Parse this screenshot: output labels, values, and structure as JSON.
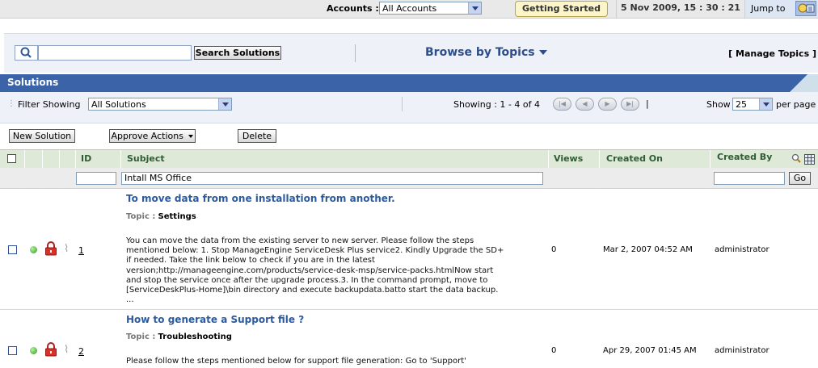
{
  "topbar": {
    "accounts_label": "Accounts :",
    "accounts_value": "All Accounts",
    "getting_started": "Getting Started",
    "datetime": "5 Nov 2009, 15 : 30 : 21",
    "jump_to": "Jump to"
  },
  "search": {
    "button": "Search Solutions",
    "browse": "Browse by Topics",
    "manage": "[ Manage Topics ]"
  },
  "section_title": "Solutions",
  "filter": {
    "label": "Filter Showing",
    "value": "All Solutions",
    "showing": "Showing : 1 - 4 of 4",
    "show_label": "Show",
    "show_value": "25",
    "per_page": "per page"
  },
  "actions": {
    "new": "New Solution",
    "approve": "Approve Actions",
    "delete": "Delete"
  },
  "columns": {
    "id": "ID",
    "subject": "Subject",
    "views": "Views",
    "created_on": "Created On",
    "created_by": "Created By"
  },
  "subject_filter": "Intall MS Office",
  "go": "Go",
  "topic_key": "Topic :",
  "rows": [
    {
      "id": "1",
      "title": "To move data from one installation from another.",
      "topic": "Settings",
      "description": "You can move the data from the existing server to new server. Please follow the steps\nmentioned below: 1. Stop ManageEngine ServiceDesk Plus service2. Kindly Upgrade the SD+\nif needed. Take the link below to check if you are in the latest\nversion;http://manageengine.com/products/service-desk-msp/service-packs.htmlNow start\nand stop the service once after the upgrade process.3. In the command prompt, move to\n[ServiceDeskPlus-Home]\\bin directory and execute backupdata.batto start the data backup.\n...",
      "views": "0",
      "created_on": "Mar 2, 2007 04:52 AM",
      "created_by": "administrator"
    },
    {
      "id": "2",
      "title": "How to generate a Support file ?",
      "topic": "Troubleshooting",
      "description": "Please follow the steps mentioned below for support file generation: Go to 'Support'",
      "views": "0",
      "created_on": "Apr 29, 2007 01:45 AM",
      "created_by": "administrator"
    }
  ]
}
